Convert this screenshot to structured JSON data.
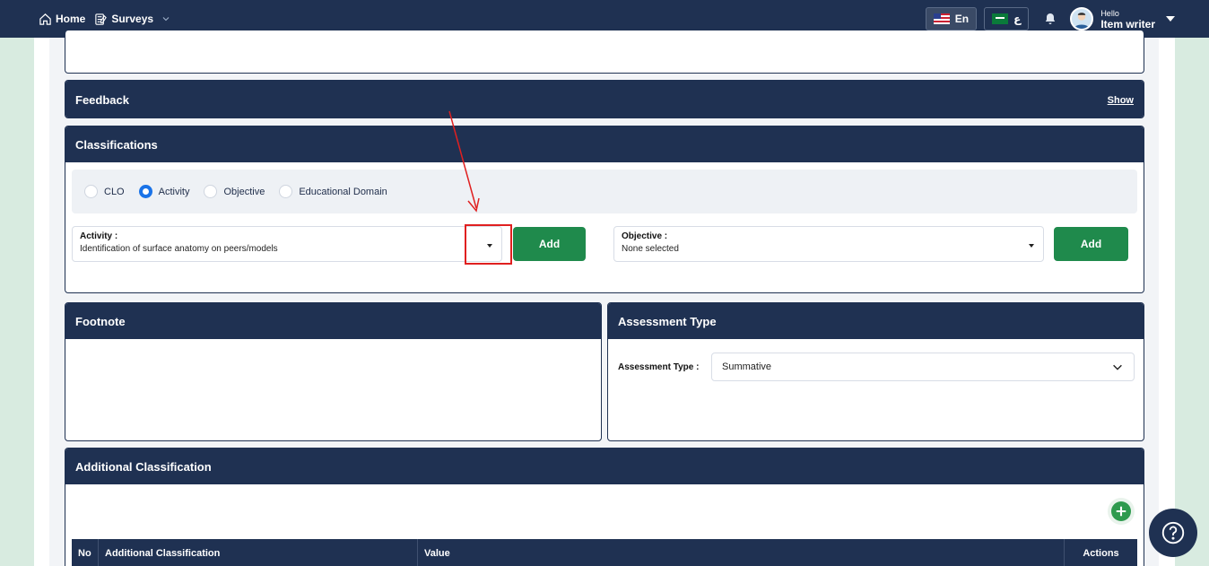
{
  "navbar": {
    "home_label": "Home",
    "surveys_label": "Surveys",
    "lang_en_label": "En",
    "lang_ar_label": "ع",
    "user_greeting": "Hello",
    "user_role": "Item writer"
  },
  "feedback": {
    "title": "Feedback",
    "show_label": "Show"
  },
  "classifications": {
    "title": "Classifications",
    "radios": [
      {
        "label": "CLO",
        "checked": false
      },
      {
        "label": "Activity",
        "checked": true
      },
      {
        "label": "Objective",
        "checked": false
      },
      {
        "label": "Educational Domain",
        "checked": false
      }
    ],
    "activity_label": "Activity :",
    "activity_value": "Identification of surface anatomy on peers/models",
    "add_label": "Add",
    "objective_label": "Objective :",
    "objective_value": "None selected",
    "add2_label": "Add"
  },
  "footnote": {
    "title": "Footnote"
  },
  "assessment": {
    "title": "Assessment Type",
    "field_label": "Assessment Type :",
    "value": "Summative"
  },
  "additional": {
    "title": "Additional Classification",
    "columns": [
      "No",
      "Additional Classification",
      "Value",
      "Actions"
    ]
  },
  "colors": {
    "navy": "#1f3152",
    "green": "#1f8a4c",
    "highlight_red": "#e02020"
  }
}
